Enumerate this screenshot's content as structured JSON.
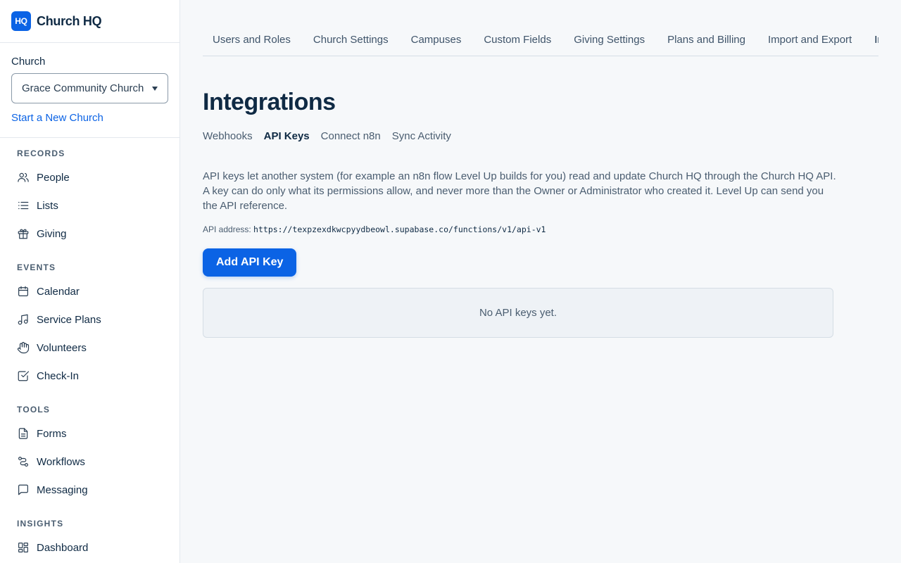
{
  "brand": {
    "logo_text": "HQ",
    "name": "Church HQ"
  },
  "church": {
    "label": "Church",
    "selected": "Grace Community Church",
    "new_church_link": "Start a New Church"
  },
  "nav": [
    {
      "heading": "RECORDS",
      "items": [
        {
          "label": "People",
          "icon": "people-icon"
        },
        {
          "label": "Lists",
          "icon": "list-icon"
        },
        {
          "label": "Giving",
          "icon": "gift-icon"
        }
      ]
    },
    {
      "heading": "EVENTS",
      "items": [
        {
          "label": "Calendar",
          "icon": "calendar-icon"
        },
        {
          "label": "Service Plans",
          "icon": "music-note-icon"
        },
        {
          "label": "Volunteers",
          "icon": "hand-icon"
        },
        {
          "label": "Check-In",
          "icon": "checkbox-icon"
        }
      ]
    },
    {
      "heading": "TOOLS",
      "items": [
        {
          "label": "Forms",
          "icon": "document-icon"
        },
        {
          "label": "Workflows",
          "icon": "workflow-icon"
        },
        {
          "label": "Messaging",
          "icon": "message-icon"
        }
      ]
    },
    {
      "heading": "INSIGHTS",
      "items": [
        {
          "label": "Dashboard",
          "icon": "dashboard-icon"
        }
      ]
    }
  ],
  "tabs": [
    {
      "label": "Users and Roles",
      "active": false
    },
    {
      "label": "Church Settings",
      "active": false
    },
    {
      "label": "Campuses",
      "active": false
    },
    {
      "label": "Custom Fields",
      "active": false
    },
    {
      "label": "Giving Settings",
      "active": false
    },
    {
      "label": "Plans and Billing",
      "active": false
    },
    {
      "label": "Import and Export",
      "active": false
    },
    {
      "label": "Integrations",
      "active": true
    }
  ],
  "page": {
    "title": "Integrations",
    "subtabs": [
      {
        "label": "Webhooks",
        "active": false
      },
      {
        "label": "API Keys",
        "active": true
      },
      {
        "label": "Connect n8n",
        "active": false
      },
      {
        "label": "Sync Activity",
        "active": false
      }
    ],
    "description": "API keys let another system (for example an n8n flow Level Up builds for you) read and update Church HQ through the Church HQ API. A key can do only what its permissions allow, and never more than the Owner or Administrator who created it. Level Up can send you the API reference.",
    "api_address_label": "API address:",
    "api_address": "https://texpzexdkwcpyydbeowl.supabase.co/functions/v1/api-v1",
    "add_button": "Add API Key",
    "empty_state": "No API keys yet."
  },
  "colors": {
    "accent": "#0b63e5",
    "text": "#0f2a44",
    "muted": "#4a5d70",
    "background": "#f6f8fa"
  }
}
